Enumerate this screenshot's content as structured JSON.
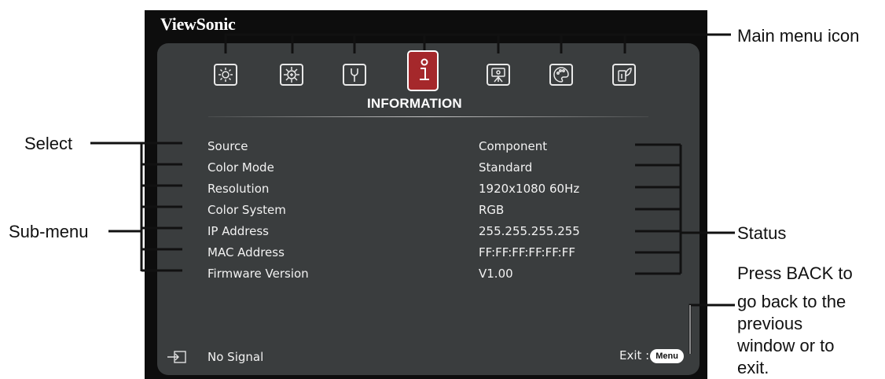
{
  "brand": "ViewSonic",
  "menu": {
    "title": "INFORMATION",
    "tabs": [
      {
        "icon": "display-gear-icon",
        "active": false
      },
      {
        "icon": "picture-adjust-icon",
        "active": false
      },
      {
        "icon": "wrench-setup-icon",
        "active": false
      },
      {
        "icon": "information-icon",
        "active": true
      },
      {
        "icon": "projector-icon",
        "active": false
      },
      {
        "icon": "palette-icon",
        "active": false
      },
      {
        "icon": "energy-leaf-icon",
        "active": false
      }
    ]
  },
  "rows": [
    {
      "label": "Source",
      "value": "Component"
    },
    {
      "label": "Color Mode",
      "value": "Standard"
    },
    {
      "label": "Resolution",
      "value": "1920x1080 60Hz"
    },
    {
      "label": "Color System",
      "value": "RGB"
    },
    {
      "label": "IP Address",
      "value": "255.255.255.255"
    },
    {
      "label": "MAC Address",
      "value": "FF:FF:FF:FF:FF:FF"
    },
    {
      "label": "Firmware Version",
      "value": "V1.00"
    }
  ],
  "footer": {
    "signal_text": "No Signal",
    "exit_label": "Exit :",
    "menu_button": "Menu"
  },
  "callouts": {
    "main_menu_icon": "Main menu icon",
    "select": "Select",
    "sub_menu": "Sub-menu",
    "status": "Status",
    "back_line1": "Press BACK to",
    "back_line2": "go back to the",
    "back_line3": "previous",
    "back_line4": "window or to",
    "back_line5": "exit."
  },
  "colors": {
    "panel": "#3a3d3e",
    "frame": "#0d0d0d",
    "active_tab": "#a5282b"
  }
}
